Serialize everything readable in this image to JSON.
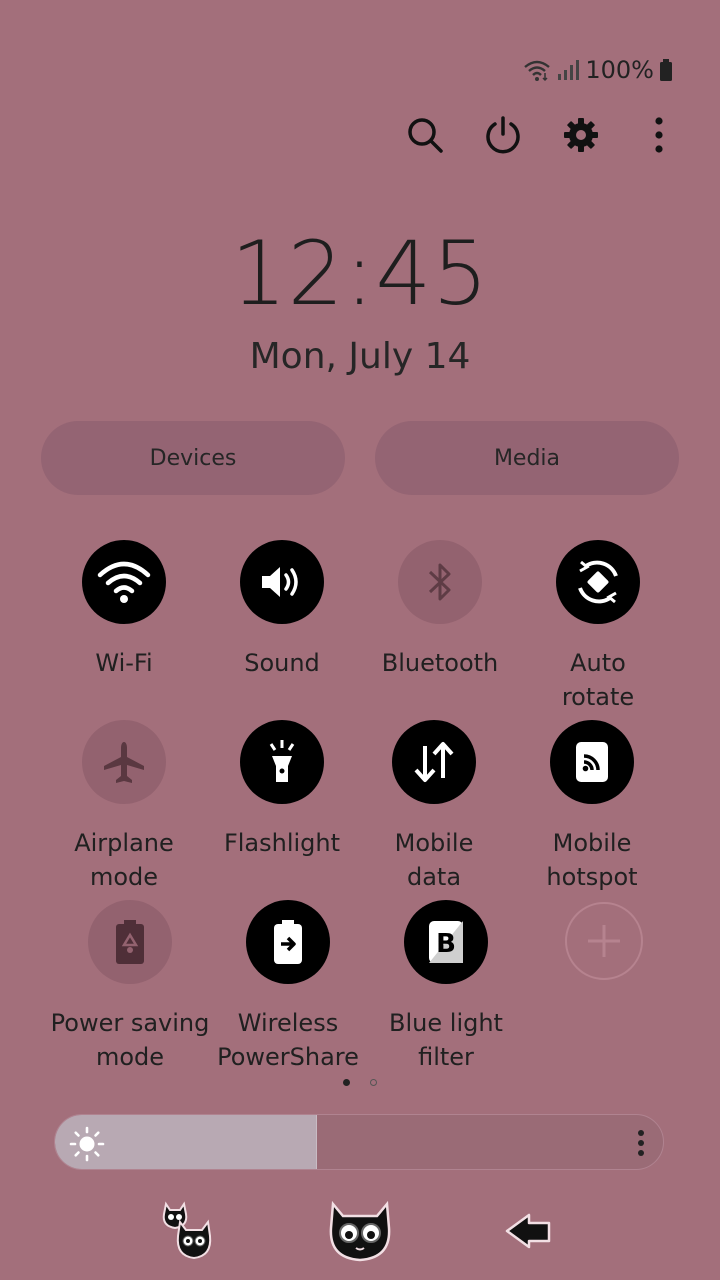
{
  "status": {
    "battery_text": "100%",
    "icons": [
      "wifi-icon",
      "signal-icon",
      "battery-icon"
    ]
  },
  "top_actions": [
    "search-icon",
    "power-icon",
    "gear-icon",
    "more-vertical-icon"
  ],
  "clock": {
    "time": "12:45",
    "date": "Mon, July 14"
  },
  "buttons": {
    "devices": "Devices",
    "media": "Media"
  },
  "tiles": [
    {
      "label": "Wi-Fi",
      "state": "on",
      "icon": "wifi-icon"
    },
    {
      "label": "Sound",
      "state": "on",
      "icon": "speaker-icon"
    },
    {
      "label": "Bluetooth",
      "state": "off",
      "icon": "bluetooth-icon"
    },
    {
      "label": "Auto\nrotate",
      "state": "on",
      "icon": "rotate-icon"
    },
    {
      "label": "Airplane\nmode",
      "state": "off",
      "icon": "airplane-icon"
    },
    {
      "label": "Flashlight",
      "state": "on",
      "icon": "flashlight-icon"
    },
    {
      "label": "Mobile\ndata",
      "state": "on",
      "icon": "data-arrows-icon"
    },
    {
      "label": "Mobile\nhotspot",
      "state": "on",
      "icon": "hotspot-icon"
    },
    {
      "label": "Power saving\nmode",
      "state": "off",
      "icon": "battery-leaf-icon"
    },
    {
      "label": "Wireless\nPowerShare",
      "state": "on",
      "icon": "powershare-icon"
    },
    {
      "label": "Blue light\nfilter",
      "state": "on",
      "icon": "blue-light-filter-icon"
    }
  ],
  "pager": {
    "pages": 2,
    "current": 1
  },
  "brightness": {
    "level_percent": 43
  },
  "colors": {
    "background": "#a36f7b",
    "tile_on": "#000000",
    "tile_off": "#93626f"
  },
  "navbar": [
    "recents-cats-icon",
    "home-cat-icon",
    "back-arrow-icon"
  ]
}
